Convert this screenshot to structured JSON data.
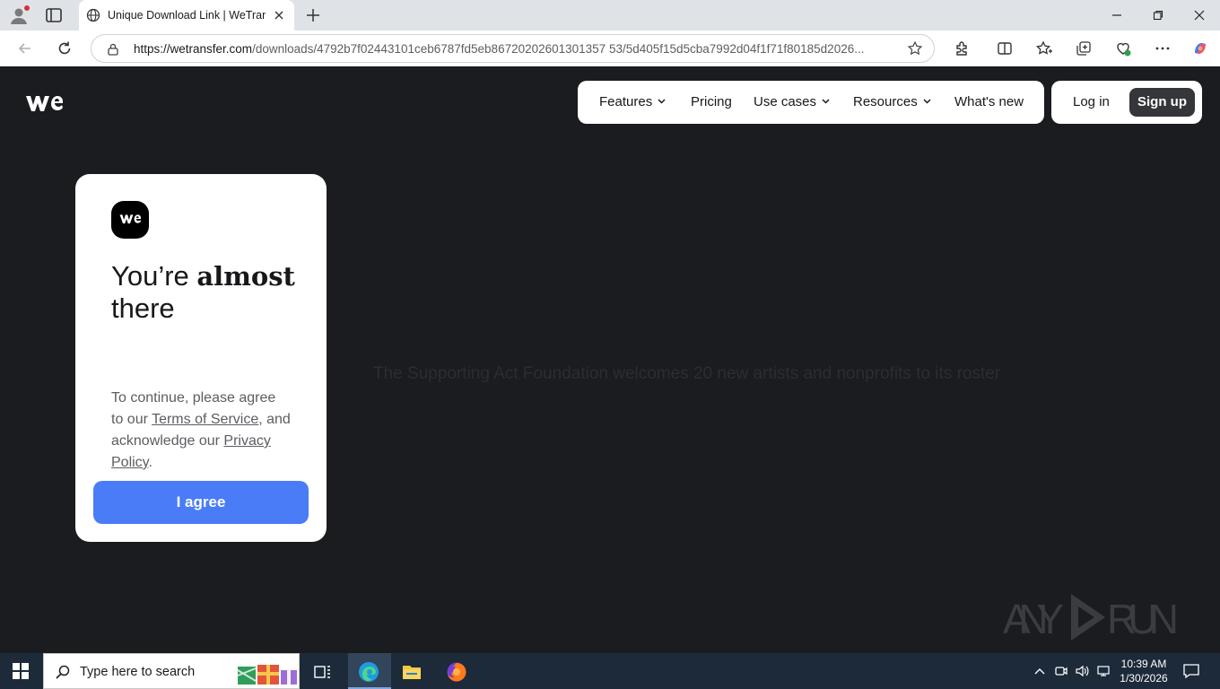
{
  "browser": {
    "tab_title": "Unique Download Link | WeTransfer",
    "url_host": "https://wetransfer.com",
    "url_path": "/downloads/4792b7f02443101ceb6787fd5eb86720202601301357 53/5d405f15d5cba7992d04f1f71f80185d2026...",
    "window_controls": [
      "minimize-icon",
      "restore-icon",
      "close-icon"
    ]
  },
  "nav": {
    "features": "Features",
    "pricing": "Pricing",
    "use_cases": "Use cases",
    "resources": "Resources",
    "whats_new": "What's new",
    "login": "Log in",
    "signup": "Sign up"
  },
  "card": {
    "headline_pre": "You’re ",
    "headline_bold": "almost",
    "headline_post": "there",
    "consent_1": "To continue, please agree to our ",
    "terms_link": "Terms of Service",
    "consent_2": ", and acknowledge our ",
    "privacy_link": "Privacy Policy",
    "consent_3": ".",
    "agree_button": "I agree"
  },
  "background_headline": "The Supporting Act Foundation welcomes 20 new artists and nonprofits to its roster",
  "watermark": {
    "brand": "ANY RUN"
  },
  "taskbar": {
    "search_placeholder": "Type here to search",
    "time": "10:39 AM",
    "date": "1/30/2026"
  },
  "colors": {
    "page_bg": "#1b1c1f",
    "agree_blue": "#4a7cf7",
    "signup_bg": "#35363a",
    "taskbar": "#1c2a3a"
  }
}
